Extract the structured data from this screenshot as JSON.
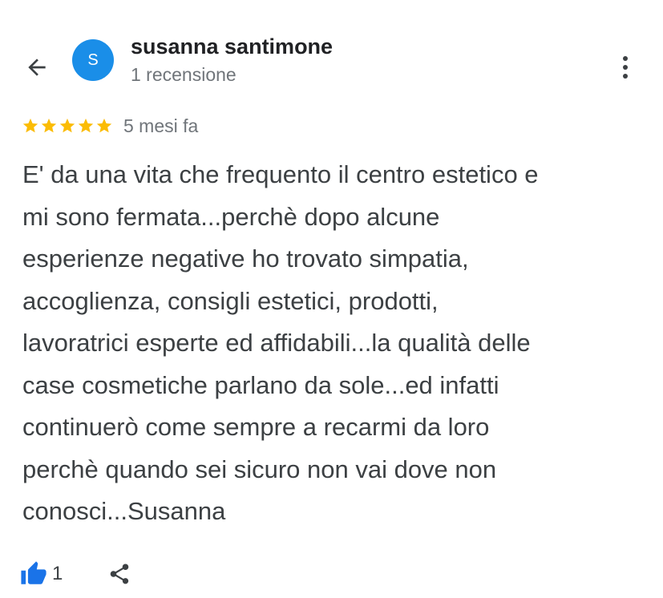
{
  "header": {
    "author_name": "susanna santimone",
    "author_meta": "1 recensione",
    "avatar_initial": "S",
    "avatar_color": "#1a8ee8"
  },
  "review": {
    "rating": 5,
    "rating_max": 5,
    "star_color": "#fbbc04",
    "date": "5 mesi fa",
    "lines": [
      "E' da una vita che frequento il centro estetico e",
      "mi sono fermata...perchè dopo alcune",
      "esperienze negative ho trovato simpatia,",
      "accoglienza, consigli estetici, prodotti,",
      "lavoratrici esperte ed affidabili...la qualità delle",
      "case cosmetiche parlano da sole...ed infatti",
      "continuerò come sempre a recarmi da loro",
      "perchè quando sei sicuro non vai dove non",
      "conosci...Susanna"
    ]
  },
  "actions": {
    "like_count": "1",
    "like_color": "#1a73e8"
  },
  "icons": {
    "back": "arrow-left-icon",
    "more": "more-vert-icon",
    "star": "star-icon",
    "like": "thumb-up-icon",
    "share": "share-icon"
  }
}
